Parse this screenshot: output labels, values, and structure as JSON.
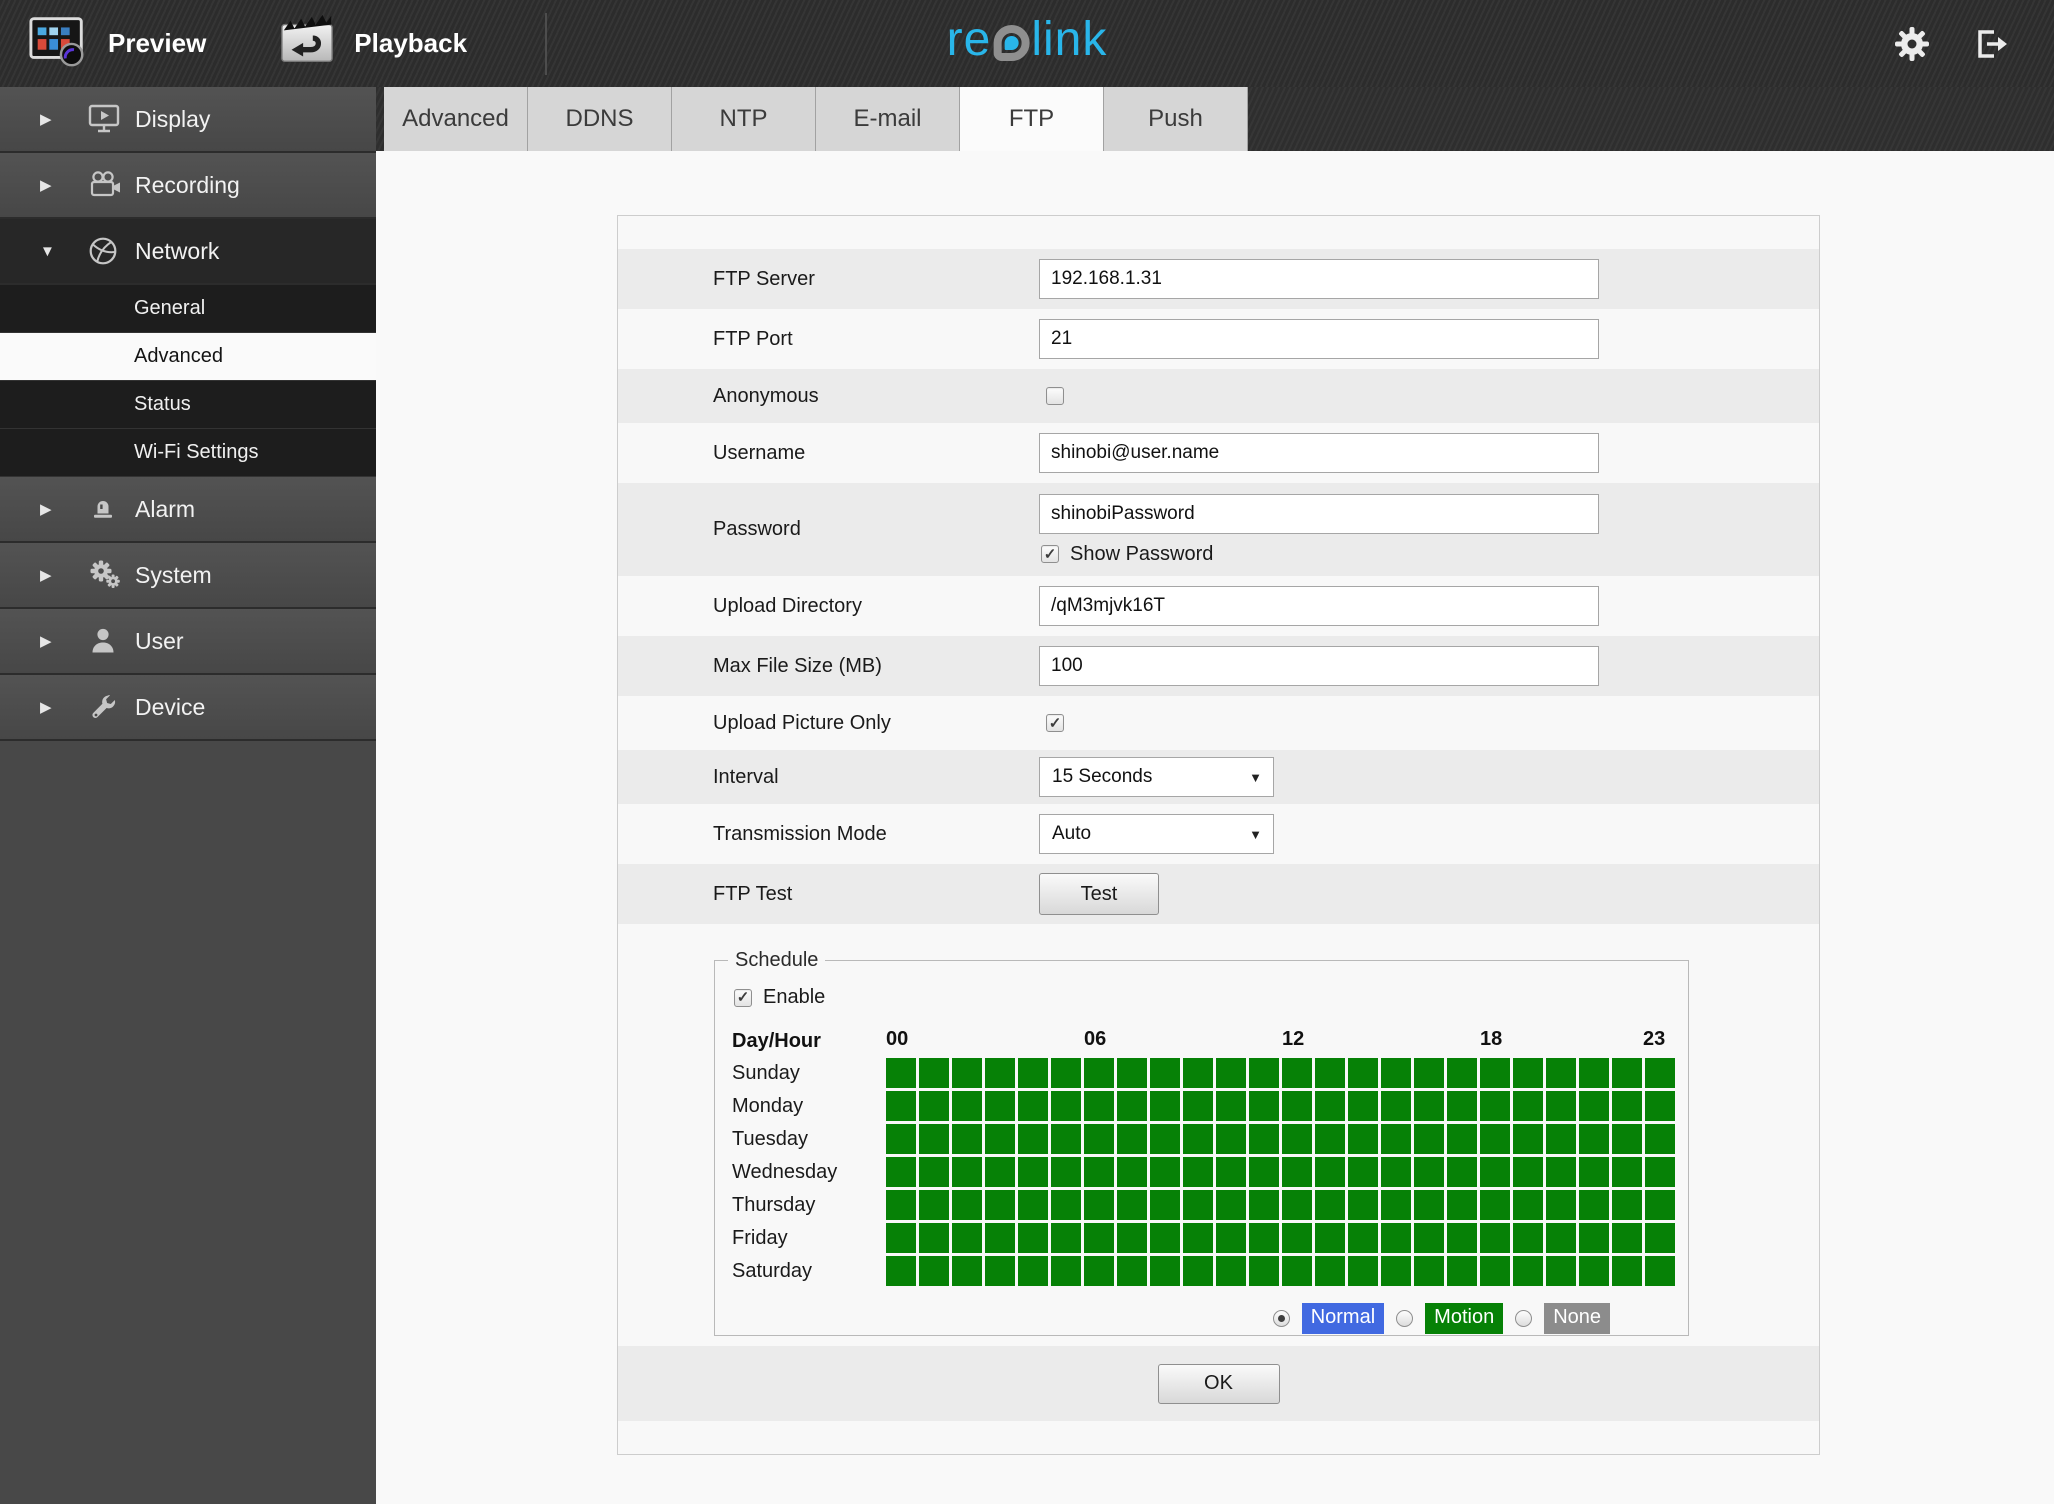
{
  "icons": {
    "collapsed": "▶",
    "expanded": "▼",
    "select_arrow": "▼",
    "check": "✓"
  },
  "colors": {
    "logo_cyan": "#29b6ea",
    "normal_blue": "#4169e1",
    "motion_green": "#068106",
    "none_gray": "#8c8c8c"
  },
  "header": {
    "preview_label": "Preview",
    "playback_label": "Playback",
    "logo_re": "re",
    "logo_link": "link"
  },
  "sidebar": {
    "items": [
      {
        "label": "Display"
      },
      {
        "label": "Recording"
      },
      {
        "label": "Network"
      },
      {
        "label": "Alarm"
      },
      {
        "label": "System"
      },
      {
        "label": "User"
      },
      {
        "label": "Device"
      }
    ],
    "network_children": [
      {
        "label": "General"
      },
      {
        "label": "Advanced",
        "selected": true
      },
      {
        "label": "Status"
      },
      {
        "label": "Wi-Fi Settings"
      }
    ]
  },
  "tabs": [
    {
      "label": "Advanced"
    },
    {
      "label": "DDNS"
    },
    {
      "label": "NTP"
    },
    {
      "label": "E-mail"
    },
    {
      "label": "FTP",
      "active": true
    },
    {
      "label": "Push"
    }
  ],
  "form": {
    "ftp_server": {
      "label": "FTP Server",
      "value": "192.168.1.31"
    },
    "ftp_port": {
      "label": "FTP Port",
      "value": "21"
    },
    "anonymous": {
      "label": "Anonymous",
      "checked": false
    },
    "username": {
      "label": "Username",
      "value": "shinobi@user.name"
    },
    "password": {
      "label": "Password",
      "value": "shinobiPassword",
      "show_password_label": "Show Password",
      "show_password_checked": true
    },
    "upload_directory": {
      "label": "Upload Directory",
      "value": "/qM3mjvk16T"
    },
    "max_file_size": {
      "label": "Max File Size (MB)",
      "value": "100"
    },
    "upload_picture_only": {
      "label": "Upload Picture Only",
      "checked": true
    },
    "interval": {
      "label": "Interval",
      "value": "15 Seconds"
    },
    "transmission_mode": {
      "label": "Transmission Mode",
      "value": "Auto"
    },
    "ftp_test": {
      "label": "FTP Test",
      "button_label": "Test"
    }
  },
  "schedule": {
    "legend": "Schedule",
    "enable_label": "Enable",
    "enable_checked": true,
    "day_hour_label": "Day/Hour",
    "hour_labels": [
      "00",
      "06",
      "12",
      "18",
      "23"
    ],
    "days": [
      "Sunday",
      "Monday",
      "Tuesday",
      "Wednesday",
      "Thursday",
      "Friday",
      "Saturday"
    ],
    "grid": {
      "rows": 7,
      "cols": 24,
      "fill_all": "motion"
    },
    "cell_color": "#068106",
    "modes": [
      {
        "label": "Normal",
        "color": "#4169e1",
        "selected": true
      },
      {
        "label": "Motion",
        "color": "#068106",
        "selected": false
      },
      {
        "label": "None",
        "color": "#8c8c8c",
        "selected": false
      }
    ]
  },
  "ok_label": "OK"
}
